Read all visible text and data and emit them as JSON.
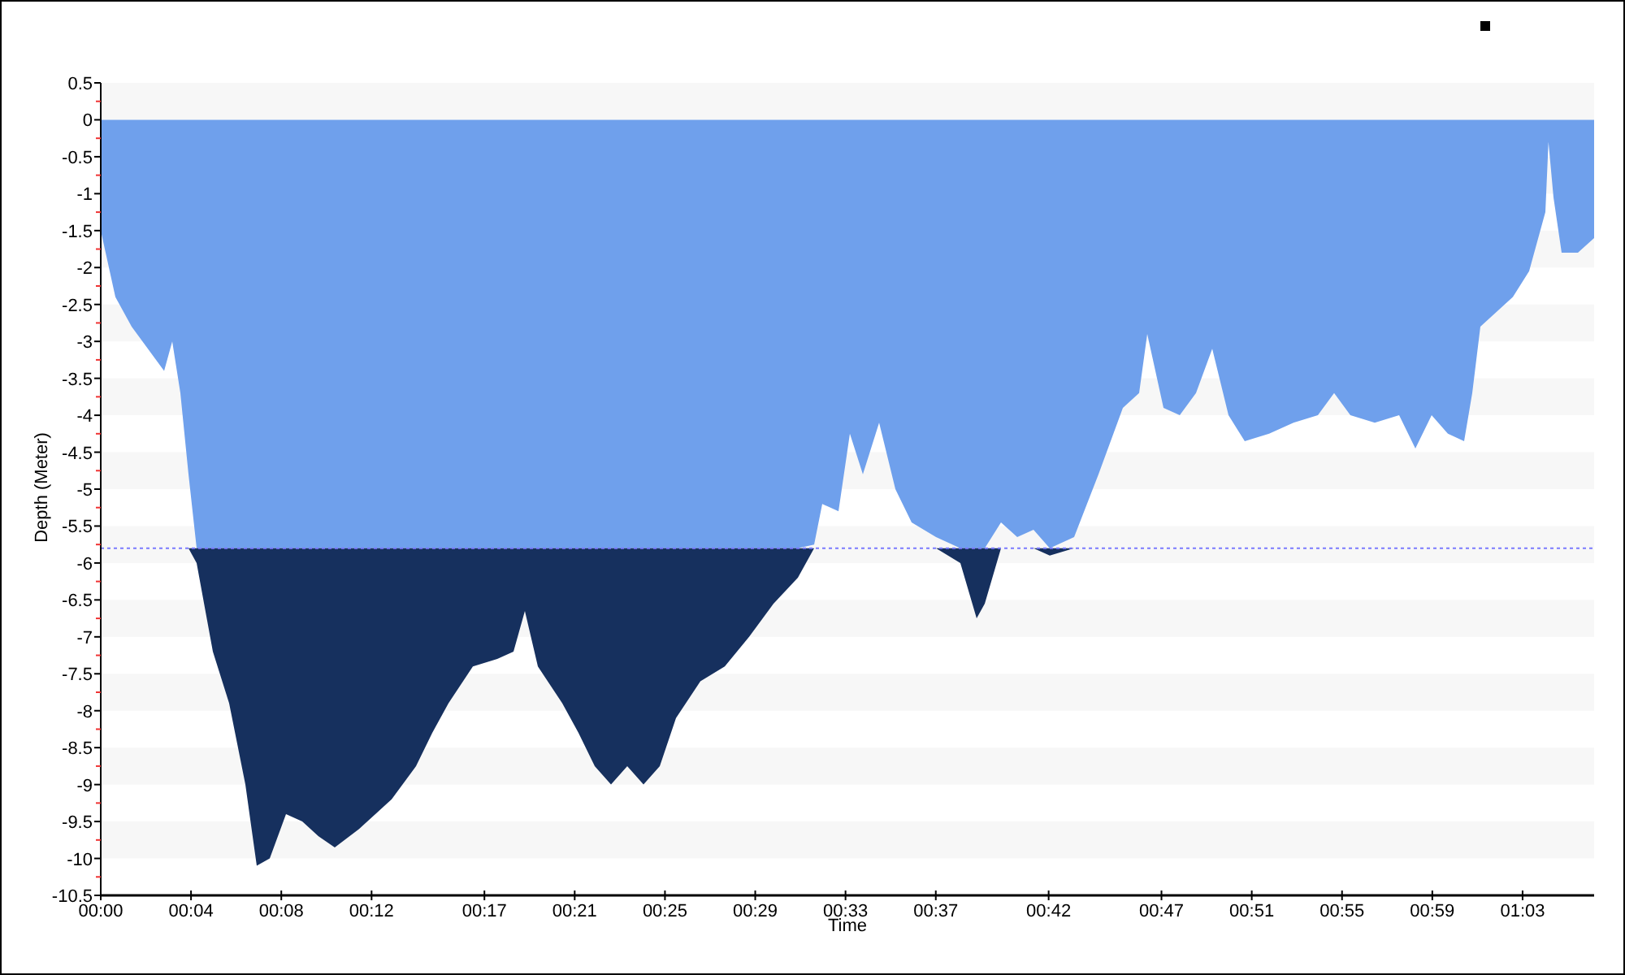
{
  "chart": {
    "chart_data": {
      "type": "area",
      "xlabel": "Time",
      "ylabel": "Depth (Meter)",
      "x": [
        0,
        0.65,
        1.37,
        2.09,
        2.81,
        3.17,
        3.53,
        3.89,
        4.25,
        4.97,
        5.69,
        6.41,
        6.91,
        7.49,
        8.21,
        8.93,
        9.65,
        10.37,
        11.45,
        12.17,
        12.89,
        13.97,
        14.69,
        15.41,
        16.49,
        17.57,
        18.29,
        18.79,
        19.37,
        20.45,
        21.17,
        21.89,
        22.61,
        23.33,
        24.05,
        24.77,
        25.49,
        26.57,
        27.65,
        28.73,
        29.81,
        30.89,
        31.61,
        31.97,
        32.69,
        33.19,
        33.77,
        34.49,
        35.21,
        35.93,
        37.01,
        38.09,
        38.81,
        39.17,
        39.89,
        40.61,
        41.33,
        42.05,
        43.13,
        44.21,
        45.29,
        46.01,
        46.37,
        47.09,
        47.81,
        48.53,
        49.25,
        49.97,
        50.69,
        51.77,
        52.85,
        53.93,
        54.65,
        55.37,
        56.45,
        57.53,
        58.25,
        58.97,
        59.69,
        60.41,
        60.77,
        61.13,
        61.85,
        62.57,
        63.29,
        64.01,
        64.15,
        64.37,
        64.73,
        65.45,
        66.17
      ],
      "series": [
        {
          "color": "#6fa0ec",
          "values": [
            -1.5,
            -2.4,
            -2.8,
            -3.1,
            -3.4,
            -3.0,
            -3.7,
            -4.8,
            -5.8,
            -5.8,
            -5.8,
            -5.8,
            -5.8,
            -5.8,
            -5.8,
            -5.8,
            -5.8,
            -5.8,
            -5.8,
            -5.8,
            -5.8,
            -5.8,
            -5.8,
            -5.8,
            -5.8,
            -5.8,
            -5.8,
            -5.8,
            -5.8,
            -5.8,
            -5.8,
            -5.8,
            -5.8,
            -5.8,
            -5.8,
            -5.8,
            -5.8,
            -5.8,
            -5.8,
            -5.8,
            -5.8,
            -5.8,
            -5.75,
            -5.2,
            -5.3,
            -4.25,
            -4.8,
            -4.1,
            -5.0,
            -5.45,
            -5.65,
            -5.8,
            -5.8,
            -5.8,
            -5.45,
            -5.65,
            -5.55,
            -5.8,
            -5.65,
            -4.8,
            -3.9,
            -3.7,
            -2.9,
            -3.9,
            -4.0,
            -3.7,
            -3.1,
            -4.0,
            -4.35,
            -4.25,
            -4.1,
            -4.0,
            -3.7,
            -4.0,
            -4.1,
            -4.0,
            -4.45,
            -4.0,
            -4.25,
            -4.35,
            -3.7,
            -2.8,
            -2.6,
            -2.4,
            -2.05,
            -1.25,
            -0.3,
            -1.05,
            -1.8,
            -1.8,
            -1.6
          ]
        },
        {
          "color": "#16305e",
          "values": [
            null,
            null,
            null,
            null,
            null,
            null,
            null,
            -5.8,
            -6.0,
            -7.2,
            -7.9,
            -9.0,
            -10.1,
            -10.0,
            -9.4,
            -9.5,
            -9.7,
            -9.85,
            -9.6,
            -9.4,
            -9.2,
            -8.75,
            -8.3,
            -7.9,
            -7.4,
            -7.3,
            -7.2,
            -6.65,
            -7.4,
            -7.9,
            -8.3,
            -8.75,
            -9.0,
            -8.75,
            -9.0,
            -8.75,
            -8.1,
            -7.6,
            -7.4,
            -7.0,
            -6.55,
            -6.2,
            -5.8,
            null,
            null,
            null,
            null,
            null,
            null,
            null,
            -5.8,
            -6.0,
            -6.75,
            -6.55,
            -5.8,
            null,
            -5.8,
            -5.9,
            -5.8,
            null,
            null,
            null,
            null,
            null,
            null,
            null,
            null,
            null,
            null,
            null,
            null,
            null,
            null,
            null,
            null,
            null,
            null,
            null,
            null,
            null,
            null,
            null,
            null,
            null,
            null,
            null,
            null,
            null,
            null,
            null,
            null
          ]
        }
      ],
      "xlim": [
        0,
        66.17
      ],
      "ylim": [
        -10.5,
        0.5
      ],
      "xticks": [
        {
          "value": 0,
          "label": "00:00"
        },
        {
          "value": 4,
          "label": "00:04"
        },
        {
          "value": 8,
          "label": "00:08"
        },
        {
          "value": 12,
          "label": "00:12"
        },
        {
          "value": 17,
          "label": "00:17"
        },
        {
          "value": 21,
          "label": "00:21"
        },
        {
          "value": 25,
          "label": "00:25"
        },
        {
          "value": 29,
          "label": "00:29"
        },
        {
          "value": 33,
          "label": "00:33"
        },
        {
          "value": 37,
          "label": "00:37"
        },
        {
          "value": 42,
          "label": "00:42"
        },
        {
          "value": 47,
          "label": "00:47"
        },
        {
          "value": 51,
          "label": "00:51"
        },
        {
          "value": 55,
          "label": "00:55"
        },
        {
          "value": 59,
          "label": "00:59"
        },
        {
          "value": 63,
          "label": "01:03"
        }
      ],
      "yticks": [
        0.5,
        0,
        -0.5,
        -1,
        -1.5,
        -2,
        -2.5,
        -3,
        -3.5,
        -4,
        -4.5,
        -5,
        -5.5,
        -6,
        -6.5,
        -7,
        -7.5,
        -8,
        -8.5,
        -9,
        -9.5,
        -10,
        -10.5
      ],
      "ref_lines": [
        {
          "axis": "y",
          "value": -5.8
        }
      ]
    }
  }
}
